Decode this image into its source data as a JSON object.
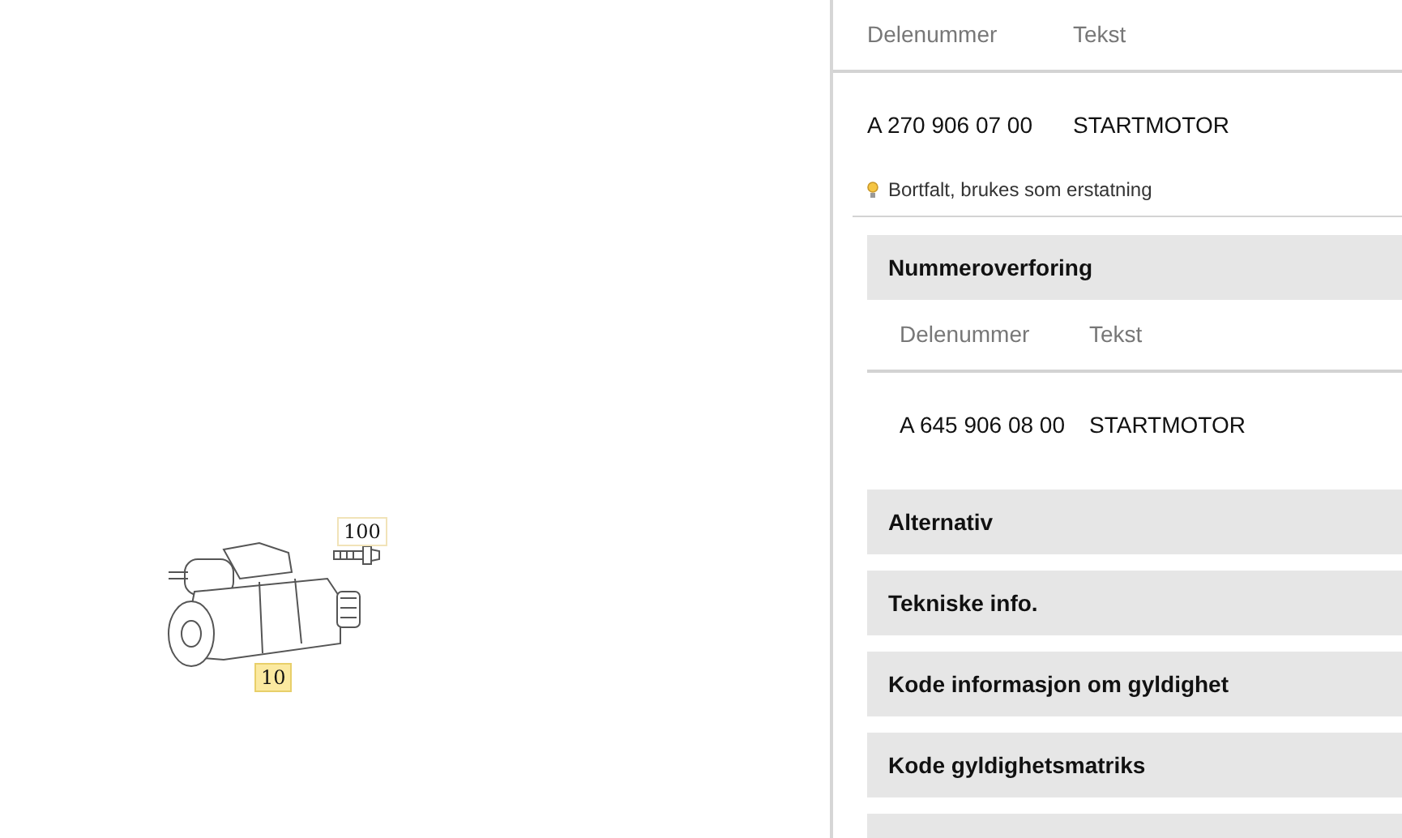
{
  "diagram": {
    "callouts": [
      {
        "label": "100",
        "kind": "bolt",
        "selected": false
      },
      {
        "label": "10",
        "kind": "motor",
        "selected": true
      }
    ]
  },
  "part_table": {
    "columns": [
      "Delenummer",
      "Tekst"
    ],
    "rows": [
      {
        "part_number": "A 270 906 07 00",
        "text": "STARTMOTOR",
        "note": "Bortfalt, brukes som erstatning"
      }
    ]
  },
  "sections": [
    {
      "title": "Nummeroverforing",
      "kind": "table",
      "columns": [
        "Delenummer",
        "Tekst"
      ],
      "rows": [
        {
          "part_number": "A 645 906 08 00",
          "text": "STARTMOTOR"
        }
      ]
    },
    {
      "title": "Alternativ",
      "kind": "header"
    },
    {
      "title": "Tekniske info.",
      "kind": "header"
    },
    {
      "title": "Kode informasjon om gyldighet",
      "kind": "header"
    },
    {
      "title": "Kode gyldighetsmatriks",
      "kind": "header"
    },
    {
      "kind": "header"
    }
  ]
}
